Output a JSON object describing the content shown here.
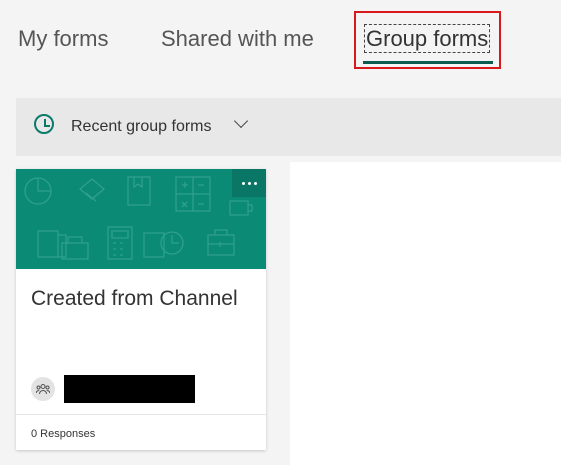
{
  "tabs": [
    {
      "label": "My forms",
      "selected": false
    },
    {
      "label": "Shared with me",
      "selected": false
    },
    {
      "label": "Group forms",
      "selected": true
    }
  ],
  "filter": {
    "label": "Recent group forms",
    "icon": "clock-icon",
    "dropdown_icon": "chevron-down-icon"
  },
  "card": {
    "title": "Created from Channel",
    "responses": "0 Responses",
    "owner_icon": "group-icon",
    "more_icon": "more-icon"
  },
  "colors": {
    "accent": "#0b8a75",
    "highlight": "#d7191e",
    "underline": "#0a5c52"
  }
}
